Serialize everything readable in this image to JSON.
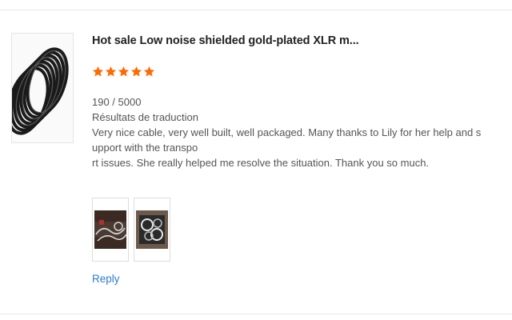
{
  "review": {
    "product_title": "Hot sale Low noise shielded gold-plated XLR m...",
    "rating": 5,
    "rating_max": 5,
    "star_color": "#ff6a00",
    "char_count": "190 / 5000",
    "translation_label": "Résultats de traduction",
    "body_line_1": "Very nice cable, very well built, well packaged. Many thanks to Lily for her help and support with the transpo",
    "body_line_2": "rt issues. She really helped me resolve the situation. Thank you so much.",
    "photos": [
      {
        "icon": "review-photo-1"
      },
      {
        "icon": "review-photo-2"
      }
    ],
    "reply_label": "Reply",
    "link_color": "#2b7cd3"
  }
}
